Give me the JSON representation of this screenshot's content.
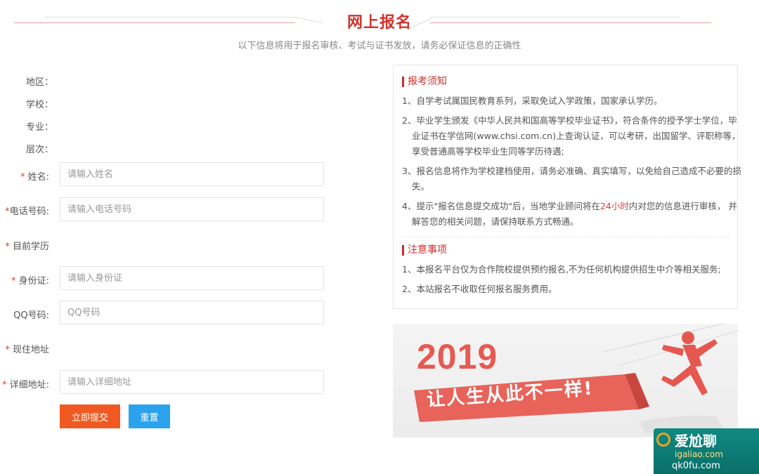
{
  "header": {
    "title": "网上报名",
    "subtitle": "以下信息将用于报名审核、考试与证书发放，请务必保证信息的正确性"
  },
  "form": {
    "info_labels": [
      "地区：",
      "学校：",
      "专业：",
      "层次："
    ],
    "required_mark": "*",
    "name": {
      "label": "姓名:",
      "placeholder": "请输入姓名"
    },
    "phone": {
      "label": "电话号码:",
      "placeholder": "请输入电话号码"
    },
    "education": {
      "label": "目前学历"
    },
    "id_card": {
      "label": "身份证:",
      "placeholder": "请输入身份证"
    },
    "qq": {
      "label": "QQ号码:",
      "placeholder": "QQ号码"
    },
    "address": {
      "label": "现住地址"
    },
    "detail_address": {
      "label": "详细地址:",
      "placeholder": "请输入详细地址"
    },
    "submit_label": "立即提交",
    "reset_label": "重置"
  },
  "notice": {
    "title1": "报考须知",
    "items1": [
      "1、自学考试属国民教育系列，采取免试入学政策，国家承认学历。",
      "2、毕业学生颁发《中华人民共和国高等学校毕业证书》，符合条件的授予学士学位，毕业证书在学信网(www.chsi.com.cn)上查询认证，可以考研，出国留学、评职称等，享受普通高等学校毕业生同等学历待遇;",
      "3、报名信息将作为学校建档使用，请务必准确、真实填写，以免给自己造成不必要的损失。"
    ],
    "item4_before": "4、提示\"报名信息提交成功\"后，当地学业顾问将在",
    "item4_highlight": "24小时",
    "item4_after": "内对您的信息进行审核， 并解答您的相关问题，请保持联系方式畅通。",
    "title2": "注意事项",
    "items2": [
      "1、本报名平台仅为合作院校提供预约报名,不为任何机构提供招生中介等相关服务;",
      "2、本站报名不收取任何报名服务费用。"
    ]
  },
  "banner": {
    "year": "2019",
    "slogan": "让人生从此不一样!"
  },
  "watermark": {
    "main": "爱尬聊",
    "sub": "igaliao.com",
    "sub2": "qk0fu.com"
  },
  "colors": {
    "accent": "#d0332e",
    "submit": "#f05a22",
    "reset": "#2ba3ec"
  }
}
